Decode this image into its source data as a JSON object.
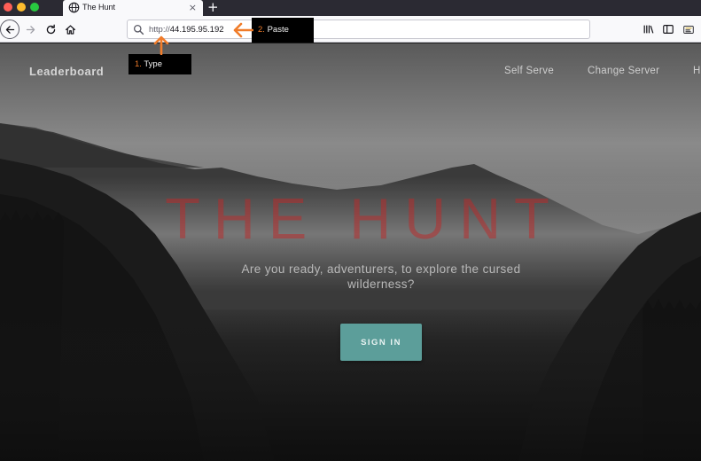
{
  "browser": {
    "tab": {
      "title": "The Hunt",
      "close": "×"
    },
    "new_tab": "+",
    "url": {
      "protocol": "http://",
      "host": "44.195.95.192"
    }
  },
  "site": {
    "brand": "Leaderboard",
    "nav": [
      {
        "label": "Self Serve"
      },
      {
        "label": "Change Server"
      },
      {
        "label": "H"
      }
    ],
    "hero": {
      "title": "THE HUNT",
      "subtitle": "Are you ready, adventurers, to explore the cursed wilderness?",
      "cta": "SIGN IN"
    }
  },
  "annotations": {
    "type": {
      "num": "1.",
      "label": "Type"
    },
    "paste": {
      "num": "2.",
      "label": "Paste"
    }
  },
  "colors": {
    "accent_button": "#5c9e9a",
    "title_red": "#be2828",
    "annotation_arrow": "#f07c2a"
  },
  "icons": [
    "globe-icon",
    "back-arrow-icon",
    "forward-arrow-icon",
    "reload-icon",
    "home-icon",
    "search-icon",
    "library-icon",
    "sidebar-icon",
    "extension-icon"
  ]
}
